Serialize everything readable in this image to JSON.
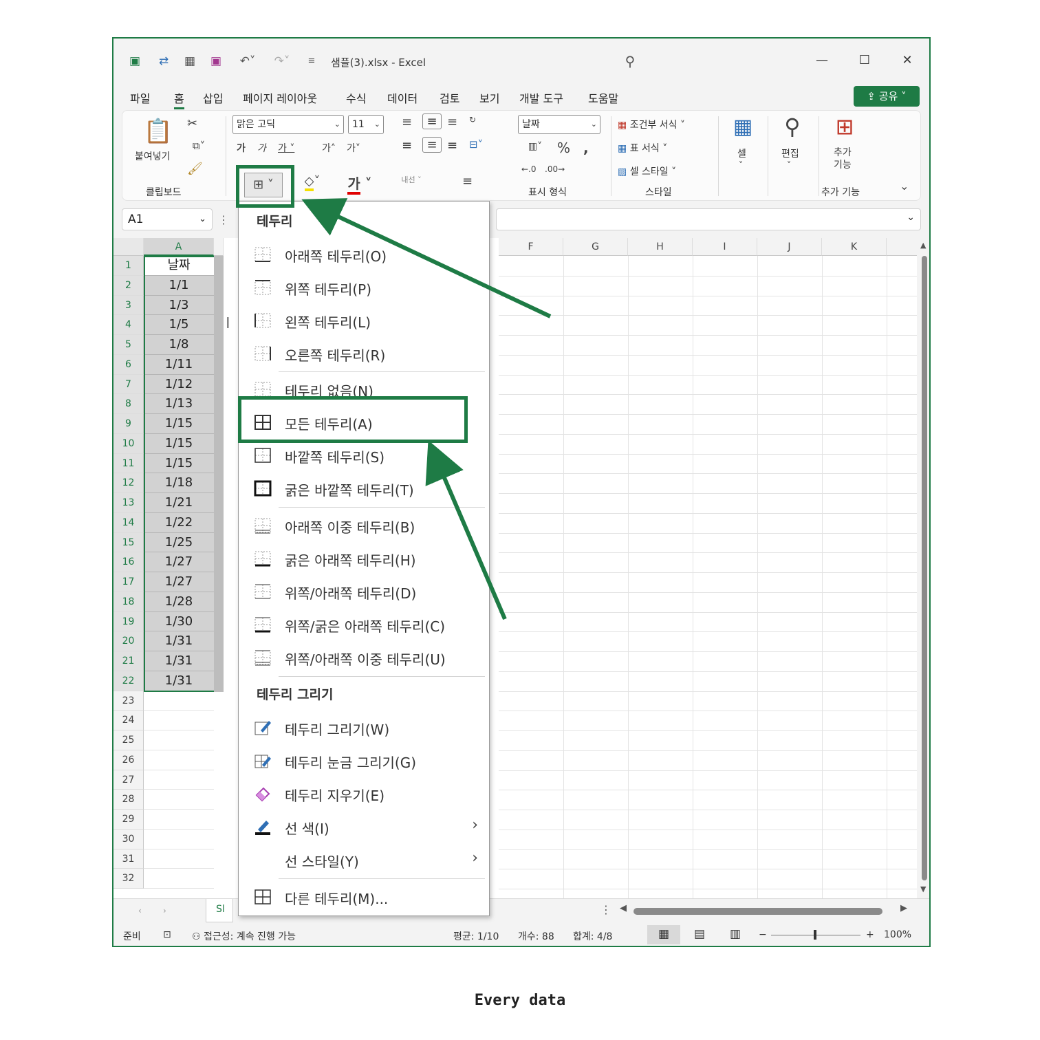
{
  "titlebar": {
    "title": "샘플(3).xlsx  -  Excel",
    "minimize": "—",
    "maximize": "☐",
    "close": "✕"
  },
  "menu": {
    "tabs": [
      "파일",
      "홈",
      "삽입",
      "페이지 레이아웃",
      "수식",
      "데이터",
      "검토",
      "보기",
      "개발 도구",
      "도움말"
    ],
    "active_tab": "홈",
    "share_label": "공유"
  },
  "ribbon": {
    "paste_label": "붙여넣기",
    "clipboard_group": "클립보드",
    "font_name": "맑은 고딕",
    "font_size": "11",
    "number_format": "날짜",
    "number_group": "표시 형식",
    "conditional_format": "조건부 서식",
    "table_format": "표 서식",
    "cell_style": "셀 스타일",
    "style_group": "스타일",
    "cells_label": "셀",
    "edit_label": "편집",
    "addins_label": "추가\n기능",
    "addins_group": "추가 기능",
    "wrap_text_label": "내선"
  },
  "namebox": {
    "value": "A1"
  },
  "grid": {
    "col_a": "A",
    "columns_right": [
      "F",
      "G",
      "H",
      "I",
      "J",
      "K"
    ],
    "rows": [
      {
        "n": "1",
        "a": "날짜"
      },
      {
        "n": "2",
        "a": "1/1"
      },
      {
        "n": "3",
        "a": "1/3"
      },
      {
        "n": "4",
        "a": "1/5"
      },
      {
        "n": "5",
        "a": "1/8"
      },
      {
        "n": "6",
        "a": "1/11"
      },
      {
        "n": "7",
        "a": "1/12"
      },
      {
        "n": "8",
        "a": "1/13"
      },
      {
        "n": "9",
        "a": "1/15"
      },
      {
        "n": "10",
        "a": "1/15"
      },
      {
        "n": "11",
        "a": "1/15"
      },
      {
        "n": "12",
        "a": "1/18"
      },
      {
        "n": "13",
        "a": "1/21"
      },
      {
        "n": "14",
        "a": "1/22"
      },
      {
        "n": "15",
        "a": "1/25"
      },
      {
        "n": "16",
        "a": "1/27"
      },
      {
        "n": "17",
        "a": "1/27"
      },
      {
        "n": "18",
        "a": "1/28"
      },
      {
        "n": "19",
        "a": "1/30"
      },
      {
        "n": "20",
        "a": "1/31"
      },
      {
        "n": "21",
        "a": "1/31"
      },
      {
        "n": "22",
        "a": "1/31"
      },
      {
        "n": "23",
        "a": ""
      },
      {
        "n": "24",
        "a": ""
      },
      {
        "n": "25",
        "a": ""
      },
      {
        "n": "26",
        "a": ""
      },
      {
        "n": "27",
        "a": ""
      },
      {
        "n": "28",
        "a": ""
      },
      {
        "n": "29",
        "a": ""
      },
      {
        "n": "30",
        "a": ""
      },
      {
        "n": "31",
        "a": ""
      },
      {
        "n": "32",
        "a": ""
      }
    ],
    "sheet_tab_partial": "Sl"
  },
  "statusbar": {
    "ready": "준비",
    "accessibility": "접근성: 계속 진행 가능",
    "average": "평균: 1/10",
    "count": "개수: 88",
    "sum": "합계: 4/8",
    "zoom": "100%"
  },
  "border_menu": {
    "header": "테두리",
    "items_1": [
      "아래쪽 테두리(O)",
      "위쪽 테두리(P)",
      "왼쪽 테두리(L)",
      "오른쪽 테두리(R)"
    ],
    "items_2": [
      "테두리 없음(N)",
      "모든 테두리(A)",
      "바깥쪽 테두리(S)",
      "굵은 바깥쪽 테두리(T)"
    ],
    "items_3": [
      "아래쪽 이중 테두리(B)",
      "굵은 아래쪽 테두리(H)",
      "위쪽/아래쪽 테두리(D)",
      "위쪽/굵은 아래쪽 테두리(C)",
      "위쪽/아래쪽 이중 테두리(U)"
    ],
    "draw_header": "테두리 그리기",
    "draw_items": [
      "테두리 그리기(W)",
      "테두리 눈금 그리기(G)",
      "테두리 지우기(E)",
      "선 색(I)",
      "선 스타일(Y)"
    ],
    "more": "다른 테두리(M)...",
    "highlighted_item": "모든 테두리(A)"
  },
  "annotation": {
    "color": "#1e7b45"
  },
  "caption": "Every data"
}
